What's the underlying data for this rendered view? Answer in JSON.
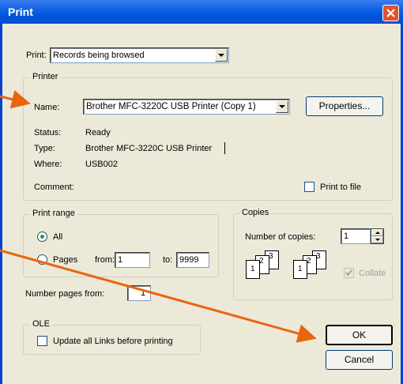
{
  "window": {
    "title": "Print"
  },
  "print_row": {
    "label": "Print:",
    "selected": "Records being browsed"
  },
  "printer": {
    "group_label": "Printer",
    "name_label": "Name:",
    "name_value": "Brother MFC-3220C USB Printer (Copy 1)",
    "properties_label": "Properties...",
    "status_label": "Status:",
    "status_value": "Ready",
    "type_label": "Type:",
    "type_value": "Brother MFC-3220C USB Printer",
    "where_label": "Where:",
    "where_value": "USB002",
    "comment_label": "Comment:",
    "print_to_file_label": "Print to file"
  },
  "print_range": {
    "group_label": "Print range",
    "all_label": "All",
    "pages_label": "Pages",
    "from_label": "from:",
    "from_value": "1",
    "to_label": "to:",
    "to_value": "9999"
  },
  "copies": {
    "group_label": "Copies",
    "number_label": "Number of copies:",
    "number_value": "1",
    "collate_label": "Collate",
    "page_numbers": [
      "1",
      "2",
      "3"
    ]
  },
  "number_pages": {
    "label": "Number pages from:",
    "value": "1"
  },
  "ole": {
    "group_label": "OLE",
    "update_links_label": "Update all Links before printing"
  },
  "buttons": {
    "ok": "OK",
    "cancel": "Cancel"
  },
  "colors": {
    "title_bar": "#0a5fe3",
    "annotation_arrow": "#e8650f",
    "dialog_bg": "#ece9d8"
  }
}
